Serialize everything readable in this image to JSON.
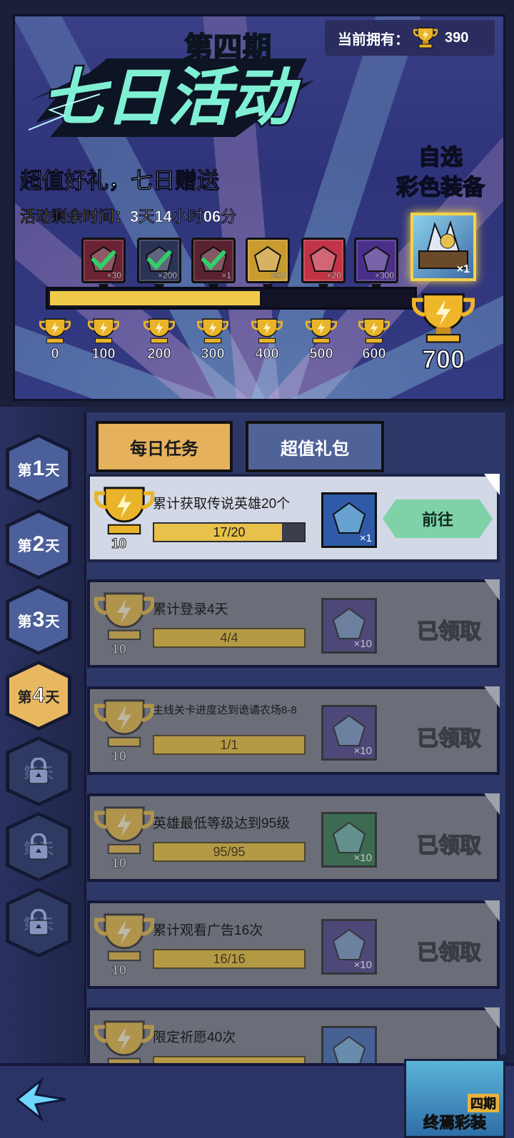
{
  "banner": {
    "period": "第四期",
    "event_title": "七日活动",
    "subtitle": "超值好礼，七日赠送",
    "remaining_label": "活动剩余时间：",
    "remaining_value": "3天14小时06分",
    "owned_label": "当前拥有：",
    "owned_value": "390",
    "final_choice_line1": "自选",
    "final_choice_line2": "彩色装备",
    "progress_value": 400,
    "progress_max": 700,
    "rewards": [
      {
        "icon": "ruby-gem-check-icon",
        "count": "×30",
        "color": "#6b2233",
        "claimed": true
      },
      {
        "icon": "emerald-gem-check-icon",
        "count": "×200",
        "color": "#2b3355",
        "claimed": true
      },
      {
        "icon": "ore-check-icon",
        "count": "×1",
        "color": "#5a2230",
        "claimed": true
      },
      {
        "icon": "red-orb-icon",
        "count": "×50",
        "color": "#c99a2e",
        "claimed": false
      },
      {
        "icon": "crystal-orb-icon",
        "count": "×20",
        "color": "#c23346",
        "claimed": false
      },
      {
        "icon": "blue-diamond-icon",
        "count": "×300",
        "color": "#4a2f8a",
        "claimed": false
      }
    ],
    "final_reward_count": "×1",
    "milestones": [
      "0",
      "100",
      "200",
      "300",
      "400",
      "500",
      "600"
    ],
    "final_milestone": "700"
  },
  "tabs": {
    "daily": "每日任务",
    "gift": "超值礼包"
  },
  "days": [
    {
      "prefix": "第",
      "num": "1",
      "suffix": "天",
      "state": "normal"
    },
    {
      "prefix": "第",
      "num": "2",
      "suffix": "天",
      "state": "normal"
    },
    {
      "prefix": "第",
      "num": "3",
      "suffix": "天",
      "state": "normal"
    },
    {
      "prefix": "第",
      "num": "4",
      "suffix": "天",
      "state": "active"
    },
    {
      "prefix": "第",
      "num": "",
      "suffix": "天",
      "state": "locked"
    },
    {
      "prefix": "第",
      "num": "",
      "suffix": "天",
      "state": "locked"
    },
    {
      "prefix": "第",
      "num": "",
      "suffix": "天",
      "state": "locked"
    }
  ],
  "tasks": [
    {
      "desc": "累计获取传说英雄20个",
      "points": "10",
      "progress": "17/20",
      "fraction": 0.85,
      "item_icon": "scroll-icon",
      "item_count": "×1",
      "item_color": "#2e5aa8",
      "action": "前往",
      "done": false
    },
    {
      "desc": "累计登录4天",
      "points": "10",
      "progress": "4/4",
      "fraction": 1,
      "item_icon": "diamond-icon",
      "item_count": "×10",
      "item_color": "#3c2f7a",
      "action": "已领取",
      "done": true
    },
    {
      "desc": "主线关卡进度达到诡谲农场8-8",
      "points": "10",
      "progress": "1/1",
      "fraction": 1,
      "item_icon": "lightning-icon",
      "item_count": "×10",
      "item_color": "#3c2f7a",
      "action": "已领取",
      "done": true
    },
    {
      "desc": "英雄最低等级达到95级",
      "points": "10",
      "progress": "95/95",
      "fraction": 1,
      "item_icon": "mystery-chest-icon",
      "item_count": "×10",
      "item_color": "#1e6a3a",
      "action": "已领取",
      "done": true
    },
    {
      "desc": "累计观看广告16次",
      "points": "10",
      "progress": "16/16",
      "fraction": 1,
      "item_icon": "diamond-icon",
      "item_count": "×10",
      "item_color": "#3c2f7a",
      "action": "已领取",
      "done": true
    },
    {
      "desc": "限定祈愿40次",
      "points": "10",
      "progress": "",
      "fraction": 1,
      "item_icon": "scroll-icon",
      "item_count": "",
      "item_color": "#2e5aa8",
      "action": "",
      "done": true
    }
  ],
  "bottom": {
    "final_label": "终焉彩装",
    "final_tag": "四期"
  }
}
